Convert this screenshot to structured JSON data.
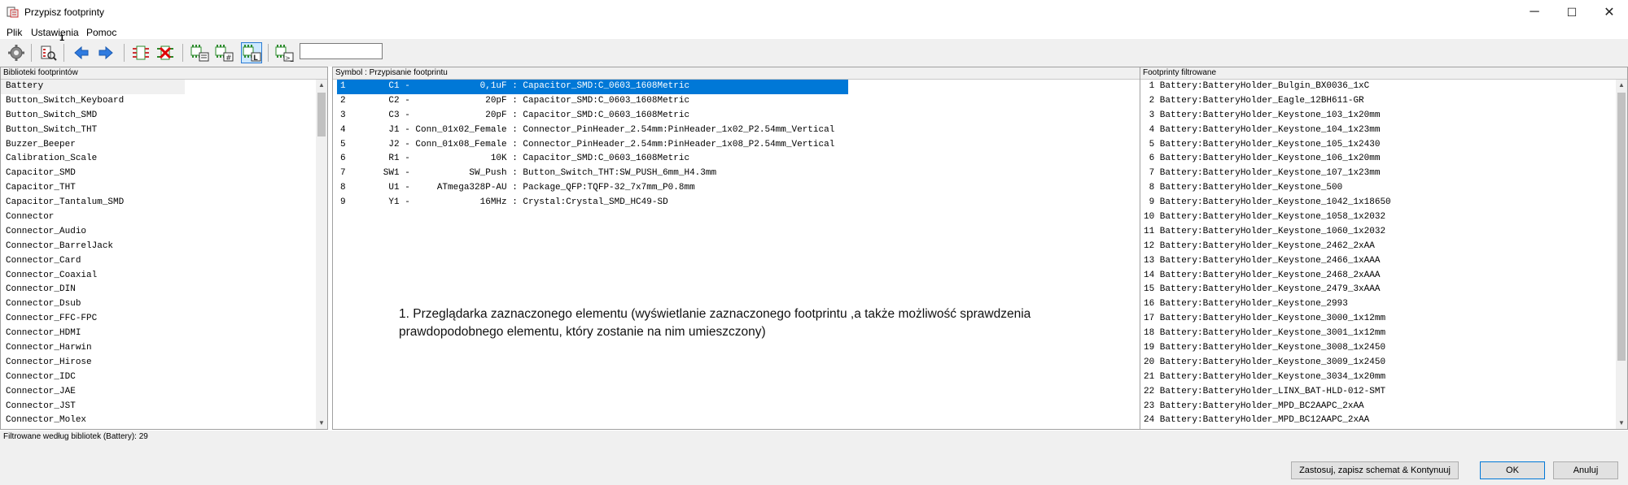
{
  "window": {
    "title": "Przypisz footprinty",
    "controls": {
      "minimize": "─",
      "maximize": "☐",
      "close": "✕"
    }
  },
  "menu": {
    "items": [
      "Plik",
      "Ustawienia",
      "Pomoc"
    ]
  },
  "toolbar": {
    "annotation_marker": "1",
    "filter_value": "",
    "buttons": [
      "settings-icon",
      "footprint-viewer-icon",
      "previous-arrow-icon",
      "next-arrow-icon",
      "auto-associate-icon",
      "delete-associations-icon",
      "filter-keywords-icon",
      "filter-pin-count-icon",
      "filter-library-icon",
      "filter-text-icon"
    ]
  },
  "panels": {
    "libraries": {
      "header": "Biblioteki footprintów",
      "items": [
        "Battery",
        "Button_Switch_Keyboard",
        "Button_Switch_SMD",
        "Button_Switch_THT",
        "Buzzer_Beeper",
        "Calibration_Scale",
        "Capacitor_SMD",
        "Capacitor_THT",
        "Capacitor_Tantalum_SMD",
        "Connector",
        "Connector_Audio",
        "Connector_BarrelJack",
        "Connector_Card",
        "Connector_Coaxial",
        "Connector_DIN",
        "Connector_Dsub",
        "Connector_FFC-FPC",
        "Connector_HDMI",
        "Connector_Harwin",
        "Connector_Hirose",
        "Connector_IDC",
        "Connector_JAE",
        "Connector_JST",
        "Connector_Molex"
      ]
    },
    "symbols": {
      "header": "Symbol : Przypisanie footprintu",
      "rows": [
        "1        C1 -             0,1uF : Capacitor_SMD:C_0603_1608Metric",
        "2        C2 -              20pF : Capacitor_SMD:C_0603_1608Metric",
        "3        C3 -              20pF : Capacitor_SMD:C_0603_1608Metric",
        "4        J1 - Conn_01x02_Female : Connector_PinHeader_2.54mm:PinHeader_1x02_P2.54mm_Vertical",
        "5        J2 - Conn_01x08_Female : Connector_PinHeader_2.54mm:PinHeader_1x08_P2.54mm_Vertical",
        "6        R1 -               10K : Capacitor_SMD:C_0603_1608Metric",
        "7       SW1 -           SW_Push : Button_Switch_THT:SW_PUSH_6mm_H4.3mm",
        "8        U1 -     ATmega328P-AU : Package_QFP:TQFP-32_7x7mm_P0.8mm",
        "9        Y1 -             16MHz : Crystal:Crystal_SMD_HC49-SD"
      ]
    },
    "footprints": {
      "header": "Footprinty filtrowane",
      "rows": [
        " 1 Battery:BatteryHolder_Bulgin_BX0036_1xC",
        " 2 Battery:BatteryHolder_Eagle_12BH611-GR",
        " 3 Battery:BatteryHolder_Keystone_103_1x20mm",
        " 4 Battery:BatteryHolder_Keystone_104_1x23mm",
        " 5 Battery:BatteryHolder_Keystone_105_1x2430",
        " 6 Battery:BatteryHolder_Keystone_106_1x20mm",
        " 7 Battery:BatteryHolder_Keystone_107_1x23mm",
        " 8 Battery:BatteryHolder_Keystone_500",
        " 9 Battery:BatteryHolder_Keystone_1042_1x18650",
        "10 Battery:BatteryHolder_Keystone_1058_1x2032",
        "11 Battery:BatteryHolder_Keystone_1060_1x2032",
        "12 Battery:BatteryHolder_Keystone_2462_2xAA",
        "13 Battery:BatteryHolder_Keystone_2466_1xAAA",
        "14 Battery:BatteryHolder_Keystone_2468_2xAAA",
        "15 Battery:BatteryHolder_Keystone_2479_3xAAA",
        "16 Battery:BatteryHolder_Keystone_2993",
        "17 Battery:BatteryHolder_Keystone_3000_1x12mm",
        "18 Battery:BatteryHolder_Keystone_3001_1x12mm",
        "19 Battery:BatteryHolder_Keystone_3008_1x2450",
        "20 Battery:BatteryHolder_Keystone_3009_1x2450",
        "21 Battery:BatteryHolder_Keystone_3034_1x20mm",
        "22 Battery:BatteryHolder_LINX_BAT-HLD-012-SMT",
        "23 Battery:BatteryHolder_MPD_BC2AAPC_2xAA",
        "24 Battery:BatteryHolder_MPD_BC12AAPC_2xAA"
      ]
    }
  },
  "annotation": "1. Przeglądarka zaznaczonego elementu (wyświetlanie zaznaczonego footprintu ,a także możliwość sprawdzenia prawdopodobnego elementu, który zostanie na nim umieszczony)",
  "status": "Filtrowane według bibliotek (Battery): 29",
  "buttons": {
    "apply": "Zastosuj, zapisz schemat & Kontynuuj",
    "ok": "OK",
    "cancel": "Anuluj"
  },
  "colors": {
    "selection": "#0078d7",
    "toolbar_bg": "#f0f0f0",
    "active_tool": "#cde8ff"
  }
}
